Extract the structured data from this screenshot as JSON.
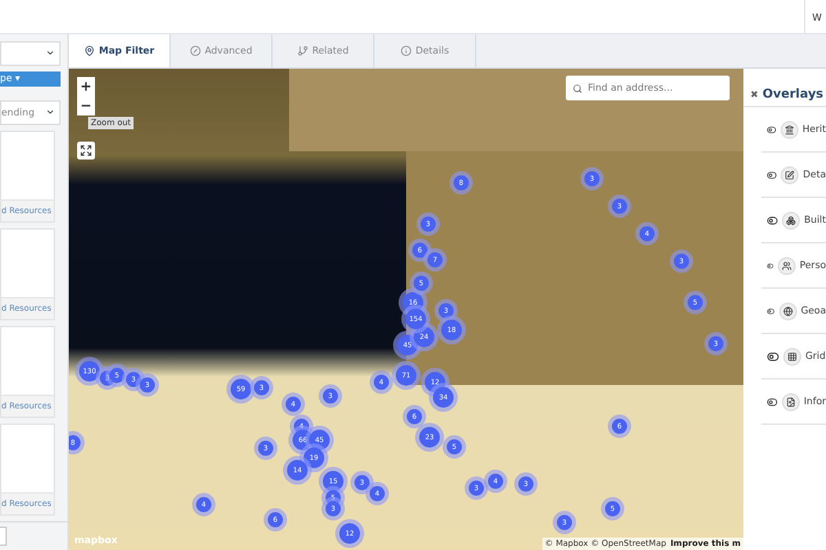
{
  "header": {
    "user_initial": "W"
  },
  "sidebar": {
    "type_button": "pe",
    "type_caret": "▾",
    "sort_select": "ending",
    "cards": [
      {
        "footer": "d Resources"
      },
      {
        "footer": "d Resources"
      },
      {
        "footer": "d Resources"
      },
      {
        "footer": "d Resources"
      }
    ]
  },
  "tabs": [
    {
      "label": "Map Filter",
      "selected": true
    },
    {
      "label": "Advanced",
      "selected": false
    },
    {
      "label": "Related",
      "selected": false
    },
    {
      "label": "Details",
      "selected": false
    }
  ],
  "map": {
    "search": {
      "placeholder": "Find an address..."
    },
    "zoom_in": "+",
    "zoom_out": "−",
    "tooltip": "Zoom out",
    "logo": "mapbox",
    "attribution": "© Mapbox © OpenStreetMap",
    "improve_link": "Improve this m",
    "clusters": [
      {
        "count": "130"
      },
      {
        "count": "3"
      },
      {
        "count": "5"
      },
      {
        "count": "3"
      },
      {
        "count": "3"
      },
      {
        "count": "59"
      },
      {
        "count": "3"
      },
      {
        "count": "4"
      },
      {
        "count": "3"
      },
      {
        "count": "8"
      },
      {
        "count": "3"
      },
      {
        "count": "4"
      },
      {
        "count": "66"
      },
      {
        "count": "45"
      },
      {
        "count": "19"
      },
      {
        "count": "14"
      },
      {
        "count": "15"
      },
      {
        "count": "5"
      },
      {
        "count": "3"
      },
      {
        "count": "12"
      },
      {
        "count": "4"
      },
      {
        "count": "6"
      },
      {
        "count": "3"
      },
      {
        "count": "4"
      },
      {
        "count": "4"
      },
      {
        "count": "71"
      },
      {
        "count": "12"
      },
      {
        "count": "34"
      },
      {
        "count": "6"
      },
      {
        "count": "23"
      },
      {
        "count": "5"
      },
      {
        "count": "45"
      },
      {
        "count": "24"
      },
      {
        "count": "16"
      },
      {
        "count": "154"
      },
      {
        "count": "3"
      },
      {
        "count": "18"
      },
      {
        "count": "8"
      },
      {
        "count": "3"
      },
      {
        "count": "6"
      },
      {
        "count": "7"
      },
      {
        "count": "5"
      },
      {
        "count": "3"
      },
      {
        "count": "4"
      },
      {
        "count": "3"
      },
      {
        "count": "3"
      },
      {
        "count": "5"
      },
      {
        "count": "3"
      },
      {
        "count": "3"
      },
      {
        "count": "4"
      },
      {
        "count": "3"
      },
      {
        "count": "5"
      },
      {
        "count": "3"
      },
      {
        "count": "6"
      }
    ]
  },
  "overlays": {
    "title": "Overlays",
    "close": "✖",
    "items": [
      {
        "label": "Herit"
      },
      {
        "label": "Deta"
      },
      {
        "label": "Built"
      },
      {
        "label": "Perso"
      },
      {
        "label": "Geoa"
      },
      {
        "label": "Grid"
      },
      {
        "label": "Infor"
      }
    ]
  }
}
